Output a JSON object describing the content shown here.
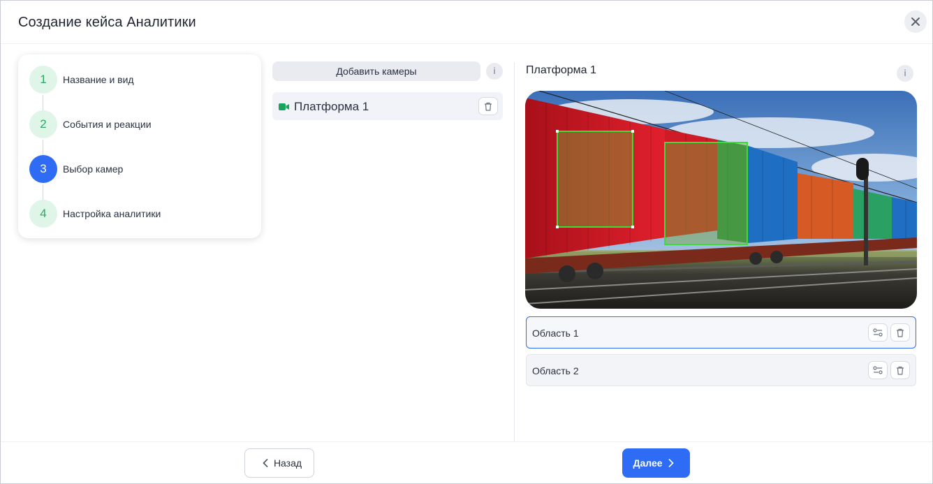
{
  "dialog": {
    "title": "Создание кейса Аналитики",
    "close_icon": "close-icon"
  },
  "stepper": {
    "current_step": 3,
    "steps": [
      {
        "number": "1",
        "label": "Название и вид",
        "state": "done"
      },
      {
        "number": "2",
        "label": "События и реакции",
        "state": "done"
      },
      {
        "number": "3",
        "label": "Выбор камер",
        "state": "active"
      },
      {
        "number": "4",
        "label": "Настройка аналитики",
        "state": "pending"
      }
    ]
  },
  "cameras": {
    "add_button_label": "Добавить камеры",
    "info_icon": "info-icon",
    "info_label": "i",
    "items": [
      {
        "label": "Платформа 1",
        "icon": "camera-icon",
        "delete_icon": "trash-icon"
      }
    ]
  },
  "preview": {
    "title": "Платформа 1",
    "info_label": "i",
    "image": "freight-train-containers-photo",
    "zone_color": "#3ddc3a"
  },
  "areas": [
    {
      "label": "Область 1",
      "selected": true,
      "settings_icon": "sliders-icon",
      "delete_icon": "trash-icon"
    },
    {
      "label": "Область 2",
      "selected": false,
      "settings_icon": "sliders-icon",
      "delete_icon": "trash-icon"
    }
  ],
  "footer": {
    "back_label": "Назад",
    "next_label": "Далее"
  },
  "colors": {
    "accent": "#2e6cf6",
    "step_done_bg": "#def5e8",
    "step_done_text": "#2aa764",
    "camera_icon": "#1aa35c"
  }
}
